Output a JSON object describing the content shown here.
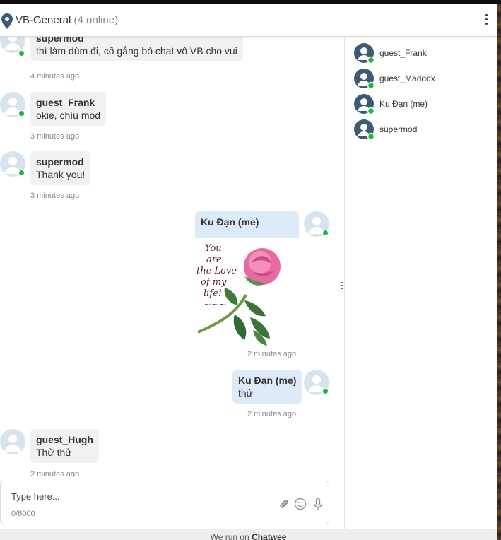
{
  "header": {
    "room_name": "VB-General",
    "online_count": "(4 online)"
  },
  "messages": [
    {
      "sender": "supermod",
      "text": "thì làm dùm đi, cố gắng bỏ chat vô VB cho vui",
      "time": "4 minutes ago",
      "mine": false
    },
    {
      "sender": "guest_Frank",
      "text": "okie, chìu mod",
      "time": "3 minutes ago",
      "mine": false
    },
    {
      "sender": "supermod",
      "text": "Thank you!",
      "time": "3 minutes ago",
      "mine": false
    },
    {
      "sender": "Ku Đạn (me)",
      "image_text": [
        "You",
        "are",
        "the Love",
        "of my",
        "life!",
        "~~~"
      ],
      "time": "2 minutes ago",
      "mine": true
    },
    {
      "sender": "Ku Đạn (me)",
      "text": "thử",
      "time": "2 minutes ago",
      "mine": true
    },
    {
      "sender": "guest_Hugh",
      "text": "Thử thử",
      "time": "2 minutes ago",
      "mine": false
    }
  ],
  "users": [
    {
      "name": "guest_Frank"
    },
    {
      "name": "guest_Maddox"
    },
    {
      "name": "Ku Đạn (me)"
    },
    {
      "name": "supermod"
    }
  ],
  "composer": {
    "placeholder": "Type here...",
    "counter": "0/6000"
  },
  "footer": {
    "prefix": "We run on ",
    "brand": "Chatwee"
  },
  "colors": {
    "online": "#1fb83d",
    "my_bubble": "#ddebf8",
    "other_bubble": "#f1f1f1",
    "avatar_dark": "#3f5b73"
  },
  "icons": {
    "room": "map-pin-icon",
    "menu": "kebab-menu-icon",
    "attach": "paperclip-icon",
    "emoji": "smiley-icon",
    "mic": "microphone-icon"
  }
}
